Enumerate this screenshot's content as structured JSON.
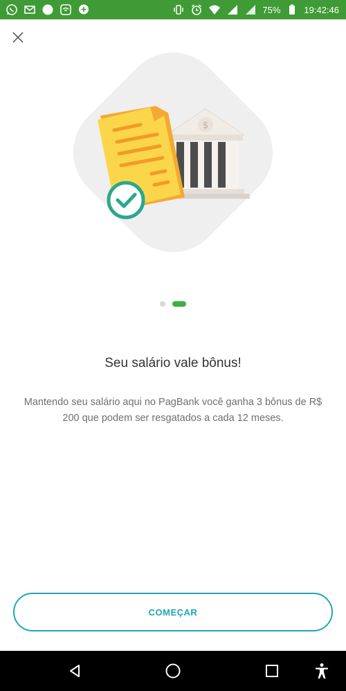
{
  "status_bar": {
    "battery": "75%",
    "time": "19:42:46",
    "left_icons": [
      "whatsapp-icon",
      "gmail-icon",
      "circle-icon",
      "wifi-box-icon",
      "chat-icon"
    ],
    "right_icons": [
      "vibrate-icon",
      "alarm-icon",
      "wifi-icon",
      "signal-icon",
      "signal-icon",
      "battery-icon"
    ],
    "bg_color": "#3f9b35"
  },
  "header": {
    "close_icon": "close-icon"
  },
  "onboarding": {
    "page_index": 2,
    "page_count": 2,
    "title": "Seu salário vale bônus!",
    "description": "Mantendo seu salário aqui no PagBank você ganha 3 bônus de R$ 200 que podem ser resgatados a cada 12 meses.",
    "start_button": "COMEÇAR",
    "accent_color": "#1fa6b8",
    "dot_active_color": "#3fae49"
  },
  "nav_bar": {
    "icons": [
      "back-icon",
      "home-icon",
      "recents-icon",
      "accessibility-icon"
    ]
  }
}
